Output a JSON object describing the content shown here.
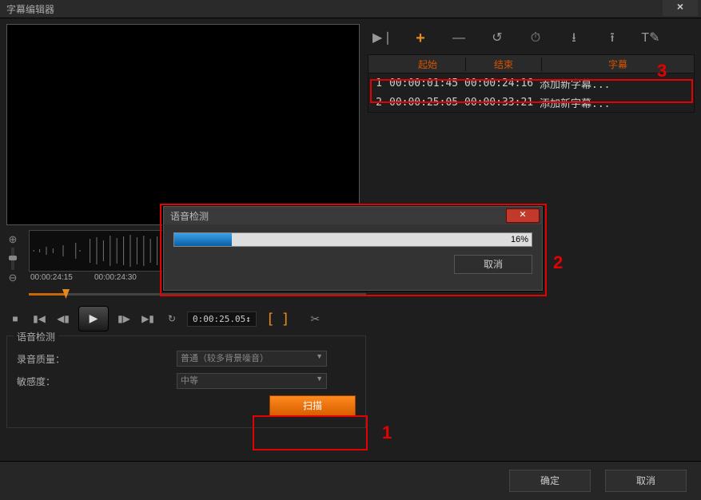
{
  "window": {
    "title": "字幕编辑器",
    "close_label": "×"
  },
  "toolbar_icons": {
    "play_insert": "▶❘",
    "add": "+",
    "remove": "—",
    "undo": "↺",
    "time_sync": "⏱",
    "import": "⭳",
    "export": "⭱",
    "text_style": "T✎"
  },
  "subtitle_list": {
    "headers": {
      "index": "",
      "start": "起始",
      "end": "结束",
      "text": "字幕"
    },
    "rows": [
      {
        "idx": "1",
        "start": "00:00:01:45",
        "end": "00:00:24:16",
        "text": "添加新字幕..."
      },
      {
        "idx": "2",
        "start": "00:00:25:05",
        "end": "00:00:33:21",
        "text": "添加新字幕..."
      }
    ]
  },
  "timeline": {
    "zoom_in": "⊕",
    "zoom_out": "⊖",
    "labels": {
      "t0": "00:00:24:15",
      "t1": "00:00:24:30"
    }
  },
  "transport": {
    "stop": "■",
    "prev": "▮◀",
    "step_back": "◀▮",
    "play": "▶",
    "step_fwd": "▮▶",
    "next": "▶▮",
    "loop": "↻",
    "timecode": "0:00:25.05↕",
    "mark_in": "[",
    "mark_out": "]",
    "cut": "✂"
  },
  "voice_detect_panel": {
    "legend": "语音检测",
    "quality_label": "录音质量：",
    "quality_value": "普通（较多背景噪音）",
    "sensitivity_label": "敏感度：",
    "sensitivity_value": "中等",
    "scan_button": "扫描"
  },
  "dialog_buttons": {
    "ok": "确定",
    "cancel": "取消"
  },
  "modal": {
    "title": "语音检测",
    "close": "✕",
    "progress_percent": 16,
    "percent_text": "16%",
    "cancel": "取消"
  },
  "annotations": {
    "n1": "1",
    "n2": "2",
    "n3": "3"
  }
}
